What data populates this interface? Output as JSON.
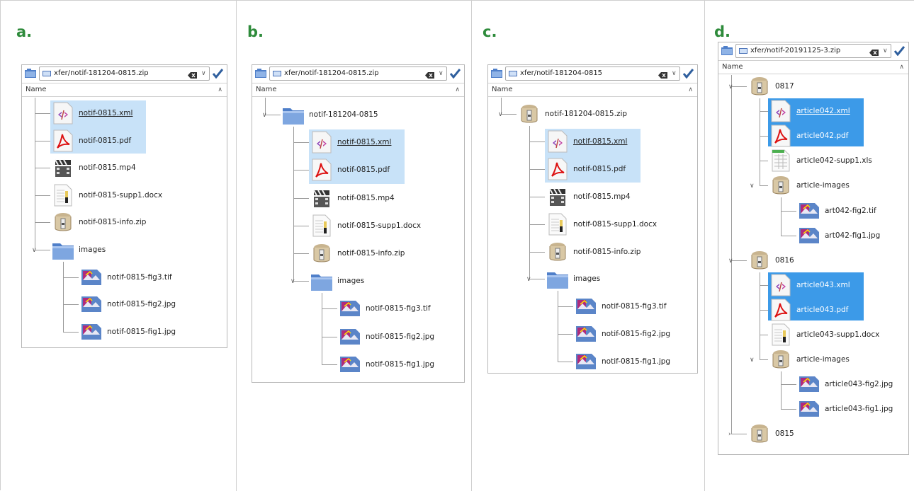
{
  "colors": {
    "label": "#2e8b3b",
    "selection": "#c8e2f8",
    "selection_strong": "#3c9ae8"
  },
  "panels": [
    {
      "label": "a.",
      "path": "xfer/notif-181204-0815.zip",
      "header": "Name",
      "items": [
        {
          "name": "notif-0815.xml",
          "icon": "xml-file-icon",
          "depth": 1,
          "selected": true,
          "underline": true
        },
        {
          "name": "notif-0815.pdf",
          "icon": "pdf-file-icon",
          "depth": 1,
          "selected": true
        },
        {
          "name": "notif-0815.mp4",
          "icon": "video-file-icon",
          "depth": 1
        },
        {
          "name": "notif-0815-supp1.docx",
          "icon": "document-file-icon",
          "depth": 1
        },
        {
          "name": "notif-0815-info.zip",
          "icon": "zip-archive-icon",
          "depth": 1
        },
        {
          "name": "images",
          "icon": "folder-icon",
          "depth": 1,
          "expanded": true
        },
        {
          "name": "notif-0815-fig3.tif",
          "icon": "image-file-icon",
          "depth": 2
        },
        {
          "name": "notif-0815-fig2.jpg",
          "icon": "image-file-icon",
          "depth": 2
        },
        {
          "name": "notif-0815-fig1.jpg",
          "icon": "image-file-icon",
          "depth": 2
        }
      ]
    },
    {
      "label": "b.",
      "path": "xfer/notif-181204-0815.zip",
      "header": "Name",
      "items": [
        {
          "name": "notif-181204-0815",
          "icon": "folder-icon",
          "depth": 1,
          "expanded": true
        },
        {
          "name": "notif-0815.xml",
          "icon": "xml-file-icon",
          "depth": 2,
          "selected": true,
          "underline": true
        },
        {
          "name": "notif-0815.pdf",
          "icon": "pdf-file-icon",
          "depth": 2,
          "selected": true
        },
        {
          "name": "notif-0815.mp4",
          "icon": "video-file-icon",
          "depth": 2
        },
        {
          "name": "notif-0815-supp1.docx",
          "icon": "document-file-icon",
          "depth": 2
        },
        {
          "name": "notif-0815-info.zip",
          "icon": "zip-archive-icon",
          "depth": 2
        },
        {
          "name": "images",
          "icon": "folder-icon",
          "depth": 2,
          "expanded": true
        },
        {
          "name": "notif-0815-fig3.tif",
          "icon": "image-file-icon",
          "depth": 3
        },
        {
          "name": "notif-0815-fig2.jpg",
          "icon": "image-file-icon",
          "depth": 3
        },
        {
          "name": "notif-0815-fig1.jpg",
          "icon": "image-file-icon",
          "depth": 3
        }
      ]
    },
    {
      "label": "c.",
      "path": "xfer/notif-181204-0815",
      "header": "Name",
      "items": [
        {
          "name": "notif-181204-0815.zip",
          "icon": "zip-archive-icon",
          "depth": 1,
          "expanded": true
        },
        {
          "name": "notif-0815.xml",
          "icon": "xml-file-icon",
          "depth": 2,
          "selected": true,
          "underline": true
        },
        {
          "name": "notif-0815.pdf",
          "icon": "pdf-file-icon",
          "depth": 2,
          "selected": true
        },
        {
          "name": "notif-0815.mp4",
          "icon": "video-file-icon",
          "depth": 2
        },
        {
          "name": "notif-0815-supp1.docx",
          "icon": "document-file-icon",
          "depth": 2
        },
        {
          "name": "notif-0815-info.zip",
          "icon": "zip-archive-icon",
          "depth": 2
        },
        {
          "name": "images",
          "icon": "folder-icon",
          "depth": 2,
          "expanded": true
        },
        {
          "name": "notif-0815-fig3.tif",
          "icon": "image-file-icon",
          "depth": 3
        },
        {
          "name": "notif-0815-fig2.jpg",
          "icon": "image-file-icon",
          "depth": 3
        },
        {
          "name": "notif-0815-fig1.jpg",
          "icon": "image-file-icon",
          "depth": 3
        }
      ]
    },
    {
      "label": "d.",
      "path": "xfer/notif-20191125-3.zip",
      "header": "Name",
      "items": [
        {
          "name": "0817",
          "icon": "zip-archive-icon",
          "depth": 1,
          "expanded": true
        },
        {
          "name": "article042.xml",
          "icon": "xml-file-icon",
          "depth": 2,
          "selected": true,
          "strong": true,
          "underline": true
        },
        {
          "name": "article042.pdf",
          "icon": "pdf-file-icon",
          "depth": 2,
          "selected": true,
          "strong": true
        },
        {
          "name": "article042-supp1.xls",
          "icon": "spreadsheet-file-icon",
          "depth": 2
        },
        {
          "name": "article-images",
          "icon": "zip-archive-icon",
          "depth": 2,
          "expanded": true
        },
        {
          "name": "art042-fig2.tif",
          "icon": "image-file-icon",
          "depth": 3
        },
        {
          "name": "art042-fig1.jpg",
          "icon": "image-file-icon",
          "depth": 3
        },
        {
          "name": "0816",
          "icon": "zip-archive-icon",
          "depth": 1,
          "expanded": true
        },
        {
          "name": "article043.xml",
          "icon": "xml-file-icon",
          "depth": 2,
          "selected": true,
          "strong": true
        },
        {
          "name": "article043.pdf",
          "icon": "pdf-file-icon",
          "depth": 2,
          "selected": true,
          "strong": true
        },
        {
          "name": "article043-supp1.docx",
          "icon": "document-file-icon",
          "depth": 2
        },
        {
          "name": "article-images",
          "icon": "zip-archive-icon",
          "depth": 2,
          "expanded": true
        },
        {
          "name": "article043-fig2.jpg",
          "icon": "image-file-icon",
          "depth": 3
        },
        {
          "name": "article043-fig1.jpg",
          "icon": "image-file-icon",
          "depth": 3
        },
        {
          "name": "0815",
          "icon": "zip-archive-icon",
          "depth": 1,
          "expanded": false
        }
      ]
    }
  ]
}
